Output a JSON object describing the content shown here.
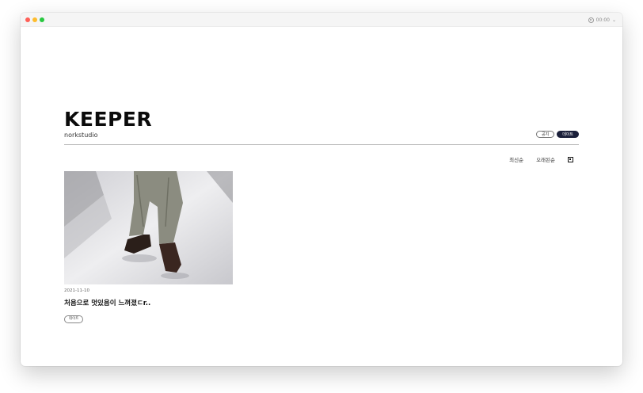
{
  "window": {
    "status_time": "00:00"
  },
  "site": {
    "brand": "KEEPER",
    "subtitle": "norkstudio"
  },
  "filters": [
    {
      "label": "공지",
      "active": false
    },
    {
      "label": "데이트",
      "active": true
    }
  ],
  "sort": {
    "latest_label": "최신순",
    "oldest_label": "오래된순"
  },
  "posts": [
    {
      "date": "2021-11-10",
      "title": "처음으로 멋있음이 느껴졌ㄷr..",
      "tag": "데이트",
      "image_description": "photo-thumbnail"
    }
  ],
  "colors": {
    "active_pill": "#1a1f3a",
    "rule": "#bdbdbd",
    "traffic_red": "#ff5f57",
    "traffic_yellow": "#febc2e",
    "traffic_green": "#28c840"
  },
  "icons": {
    "status": "record-icon",
    "dropdown": "chevron-down-icon",
    "layout": "layout-toggle-icon"
  }
}
